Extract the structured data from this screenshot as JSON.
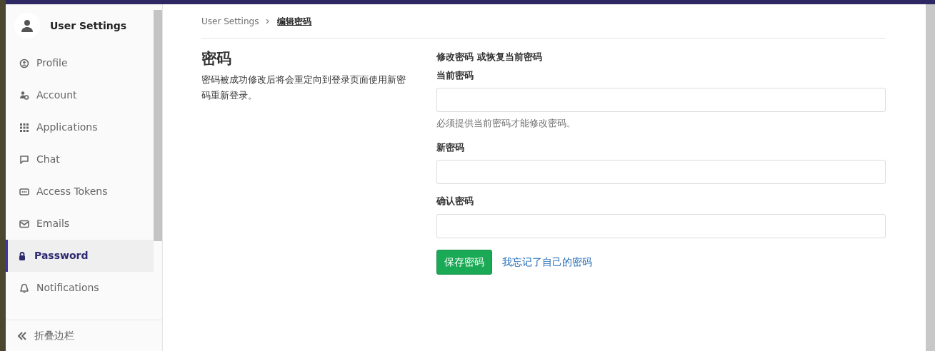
{
  "sidebar": {
    "title": "User Settings",
    "items": [
      {
        "label": "Profile",
        "selected": false
      },
      {
        "label": "Account",
        "selected": false
      },
      {
        "label": "Applications",
        "selected": false
      },
      {
        "label": "Chat",
        "selected": false
      },
      {
        "label": "Access Tokens",
        "selected": false
      },
      {
        "label": "Emails",
        "selected": false
      },
      {
        "label": "Password",
        "selected": true
      },
      {
        "label": "Notifications",
        "selected": false
      }
    ],
    "collapse": "折叠边栏"
  },
  "breadcrumb": [
    {
      "label": "User Settings",
      "current": false
    },
    {
      "label": "编辑密码",
      "current": true
    }
  ],
  "intro": {
    "title": "密码",
    "text": "密码被成功修改后将会重定向到登录页面使用新密码重新登录。"
  },
  "form": {
    "heading": "修改密码 或恢复当前密码",
    "fields": [
      {
        "label": "当前密码",
        "help": "必须提供当前密码才能修改密码。"
      },
      {
        "label": "新密码"
      },
      {
        "label": "确认密码"
      }
    ],
    "submit": "保存密码",
    "forgot": "我忘记了自己的密码"
  }
}
